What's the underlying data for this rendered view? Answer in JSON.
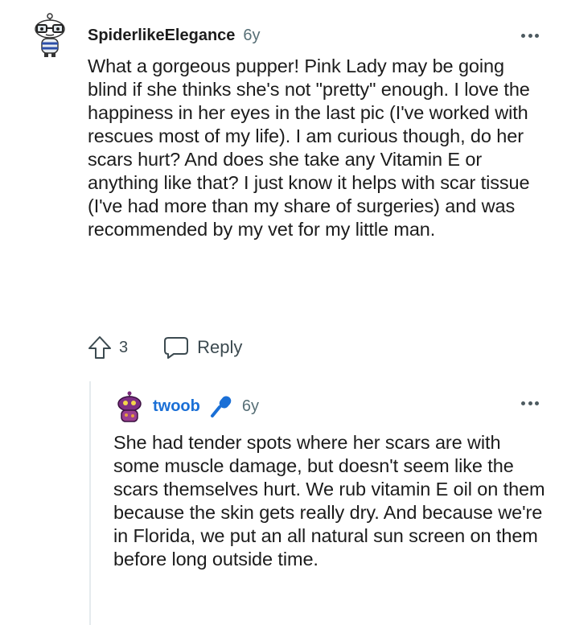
{
  "comment": {
    "username": "SpiderlikeElegance",
    "age": "6y",
    "body": "What a gorgeous pupper! Pink Lady may be going blind if she thinks she's not \"pretty\" enough. I love the happiness in her eyes in the last pic (I've worked with rescues most of my life). I am curious though, do her scars hurt? And does she take any Vitamin E or anything like that? I just know it helps with scar tissue (I've had more than my share of surgeries) and was recommended by my vet for my little man.",
    "upvotes": "3",
    "reply_label": "Reply",
    "icons": {
      "avatar": "snoo-avatar-glasses",
      "upvote": "upvote-arrow-icon",
      "reply": "speech-bubble-icon",
      "more": "more-dots-icon"
    }
  },
  "reply": {
    "username": "twoob",
    "age": "6y",
    "body": "She had tender spots where her scars are with some muscle damage, but doesn't seem like the scars themselves hurt. We rub vitamin E oil on them because the skin gets really dry. And because we're in Florida, we put an all natural sun screen on them before long outside time.",
    "colors": {
      "username": "#1a6fd6",
      "badge": "#1a6fd6"
    },
    "icons": {
      "avatar": "snoo-avatar-purple",
      "badge": "microphone-icon",
      "more": "more-dots-icon"
    }
  }
}
